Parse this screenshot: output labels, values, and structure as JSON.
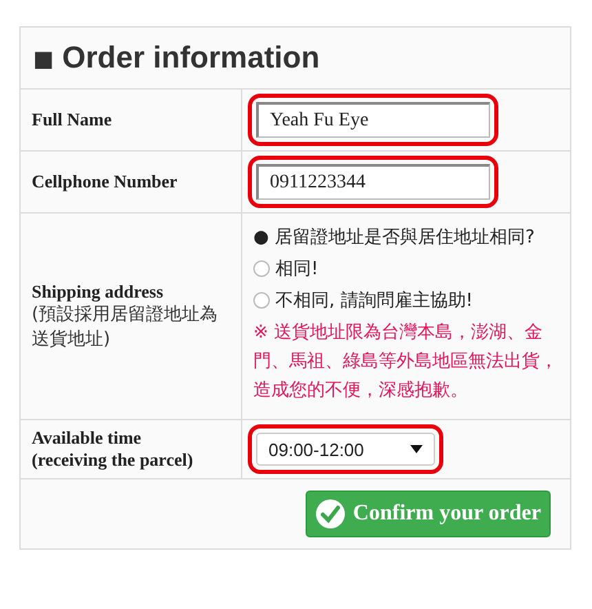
{
  "title": {
    "marker": "■",
    "text": "Order information"
  },
  "fields": [
    {
      "label": "Full Name",
      "value": "Yeah Fu Eye",
      "highlighted": true
    },
    {
      "label": "Cellphone Number",
      "value": "0911223344",
      "highlighted": true
    }
  ],
  "shipping": {
    "label": "Shipping address",
    "note": "(預設採用居留證地址為送貨地址)",
    "question": "● 居留證地址是否與居住地址相同?",
    "options": [
      {
        "label": "相同!",
        "selected": false
      },
      {
        "label": "不相同, 請詢問雇主協助!",
        "selected": false
      }
    ],
    "warning": "※ 送貨地址限為台灣本島，澎湖、金門、馬祖、綠島等外島地區無法出貨，造成您的不便，深感抱歉。"
  },
  "time": {
    "label": "Available time",
    "sublabel": "(receiving the parcel)",
    "value": "09:00-12:00",
    "highlighted": true
  },
  "button": {
    "label": "Confirm your order"
  }
}
